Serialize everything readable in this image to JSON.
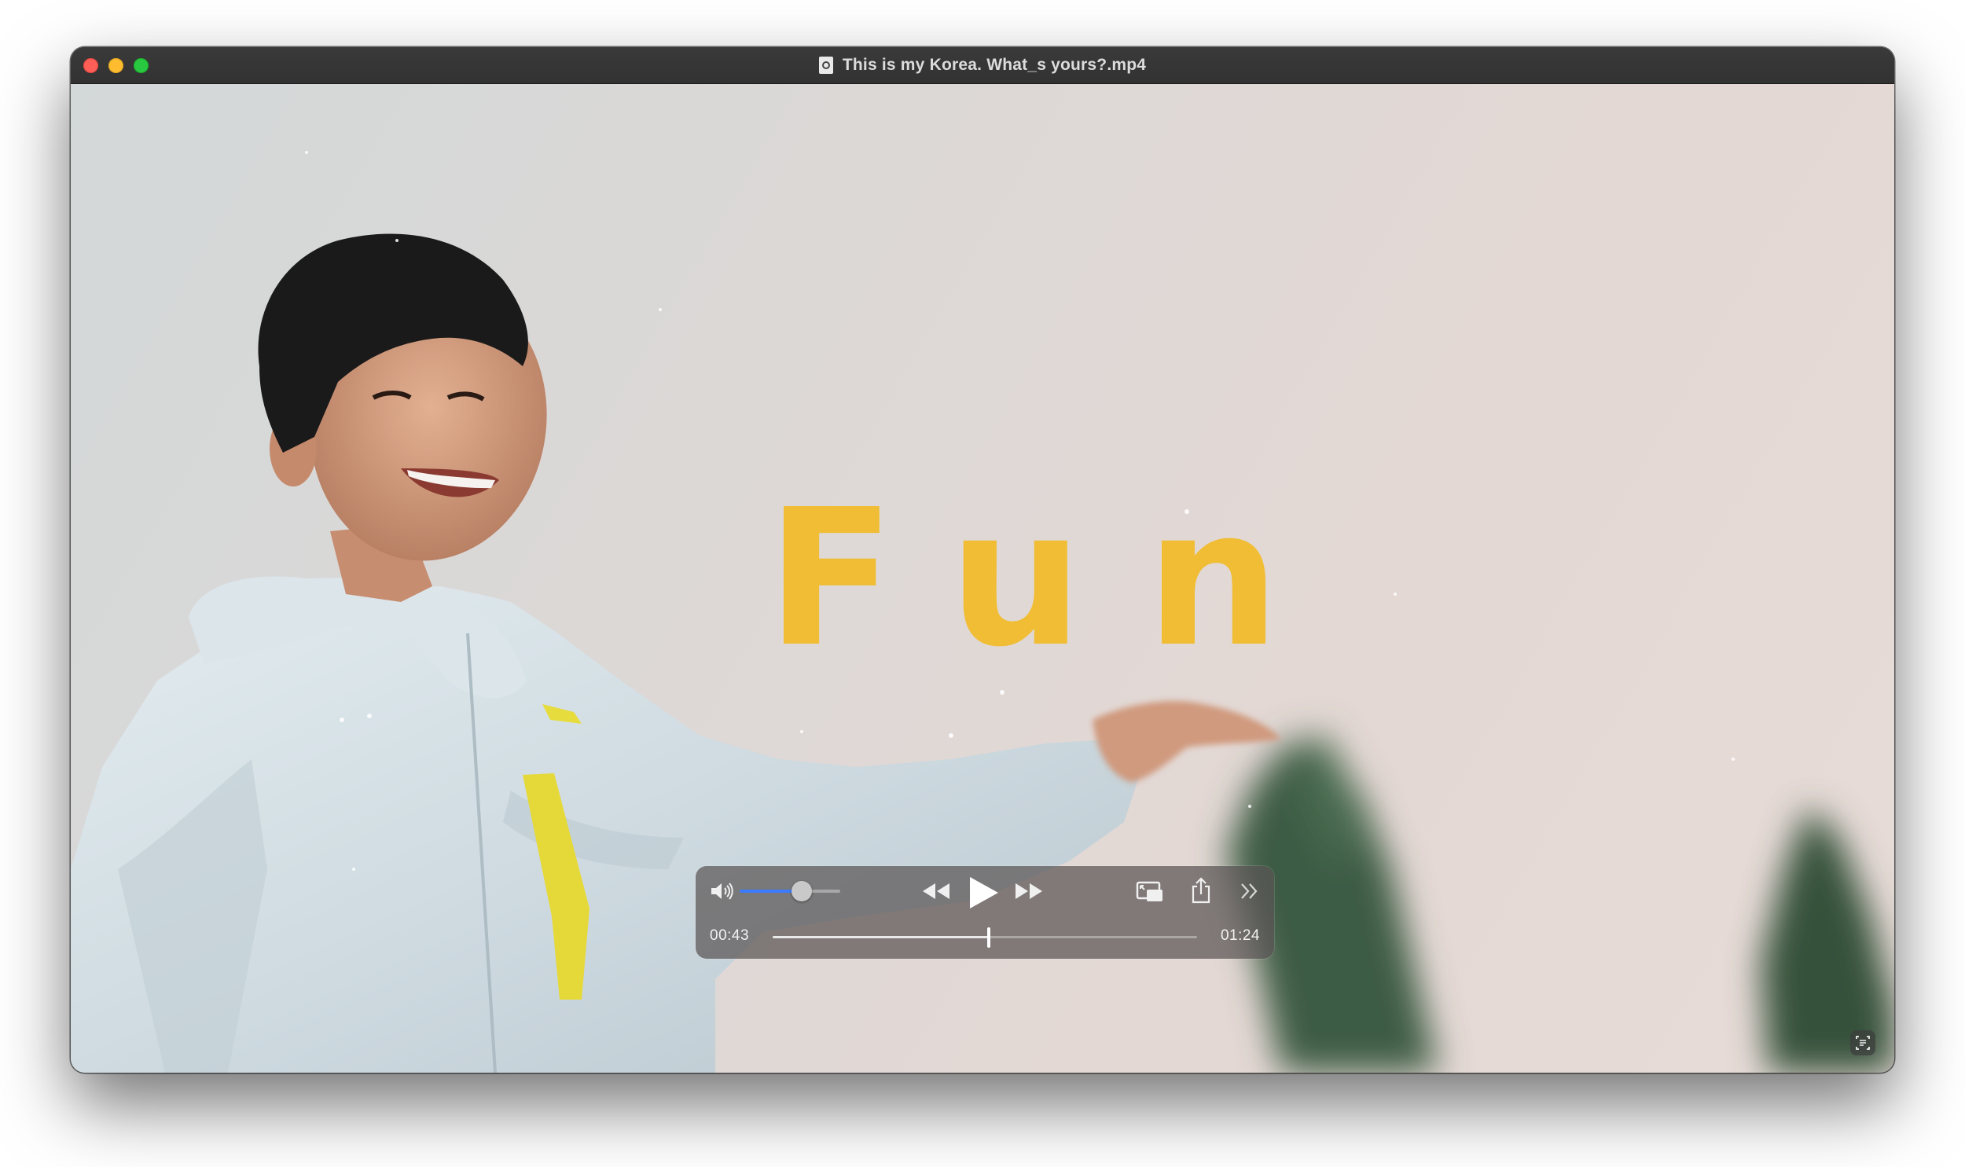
{
  "window": {
    "title": "This is my Korea. What_s yours?.mp4",
    "file_icon": "quicktime-document-icon"
  },
  "video_frame": {
    "overlay_text": "Fun",
    "overlay_text_color": "#f0bd34"
  },
  "controls": {
    "volume_icon": "speaker-icon",
    "volume_level": 0.62,
    "rewind_icon": "rewind-icon",
    "play_icon": "play-icon",
    "fast_forward_icon": "fast-forward-icon",
    "pip_icon": "picture-in-picture-icon",
    "share_icon": "share-icon",
    "more_icon": "chevron-double-right-icon",
    "elapsed": "00:43",
    "remaining": "01:24",
    "progress": 0.51,
    "accent_color": "#3a7bff"
  },
  "live_text_icon": "live-text-icon"
}
